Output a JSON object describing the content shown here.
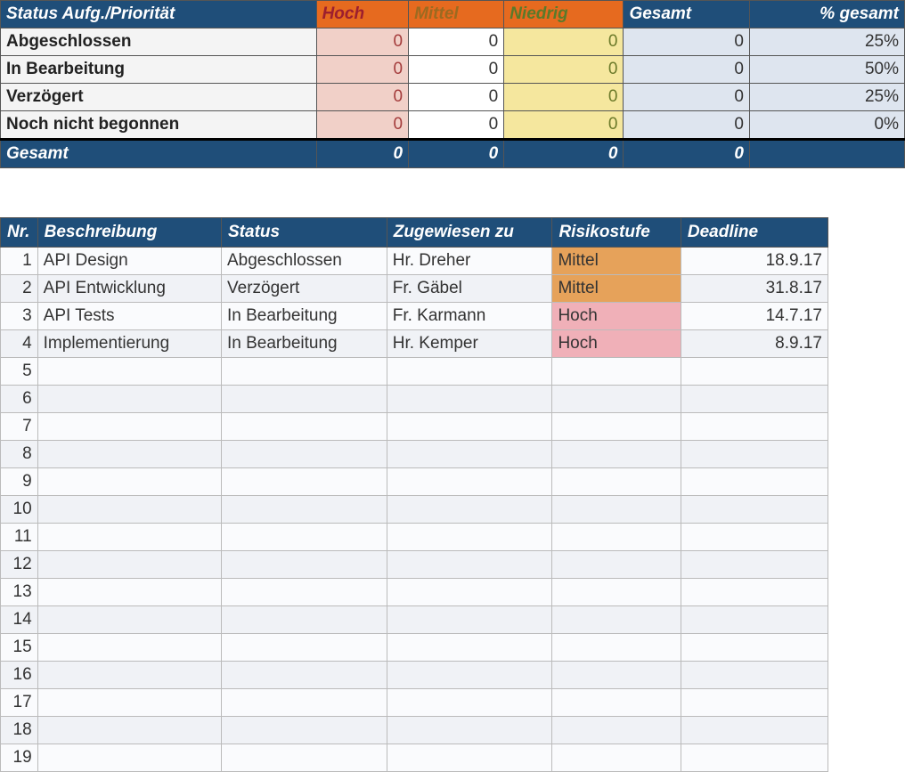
{
  "summary": {
    "header": {
      "main": "Status Aufg./Priorität",
      "hoch": "Hoch",
      "mittel": "Mittel",
      "niedrig": "Niedrig",
      "gesamt": "Gesamt",
      "pct": "% gesamt"
    },
    "rows": [
      {
        "label": "Abgeschlossen",
        "hoch": "0",
        "mittel": "0",
        "niedrig": "0",
        "gesamt": "0",
        "pct": "25%"
      },
      {
        "label": "In Bearbeitung",
        "hoch": "0",
        "mittel": "0",
        "niedrig": "0",
        "gesamt": "0",
        "pct": "50%"
      },
      {
        "label": "Verzögert",
        "hoch": "0",
        "mittel": "0",
        "niedrig": "0",
        "gesamt": "0",
        "pct": "25%"
      },
      {
        "label": "Noch nicht begonnen",
        "hoch": "0",
        "mittel": "0",
        "niedrig": "0",
        "gesamt": "0",
        "pct": "0%"
      }
    ],
    "total": {
      "label": "Gesamt",
      "hoch": "0",
      "mittel": "0",
      "niedrig": "0",
      "gesamt": "0",
      "pct": ""
    }
  },
  "tasks": {
    "header": {
      "nr": "Nr.",
      "desc": "Beschreibung",
      "status": "Status",
      "assigned": "Zugewiesen zu",
      "risk": "Risikostufe",
      "deadline": "Deadline"
    },
    "rows": [
      {
        "nr": "1",
        "desc": "API Design",
        "status": "Abgeschlossen",
        "assigned": "Hr. Dreher",
        "risk": "Mittel",
        "risk_class": "risk-mittel",
        "deadline": "18.9.17"
      },
      {
        "nr": "2",
        "desc": "API Entwicklung",
        "status": "Verzögert",
        "assigned": "Fr. Gäbel",
        "risk": "Mittel",
        "risk_class": "risk-mittel",
        "deadline": "31.8.17"
      },
      {
        "nr": "3",
        "desc": "API Tests",
        "status": "In Bearbeitung",
        "assigned": "Fr. Karmann",
        "risk": "Hoch",
        "risk_class": "risk-hoch",
        "deadline": "14.7.17"
      },
      {
        "nr": "4",
        "desc": "Implementierung",
        "status": "In Bearbeitung",
        "assigned": "Hr. Kemper",
        "risk": "Hoch",
        "risk_class": "risk-hoch",
        "deadline": "8.9.17"
      },
      {
        "nr": "5",
        "desc": "",
        "status": "",
        "assigned": "",
        "risk": "",
        "risk_class": "",
        "deadline": ""
      },
      {
        "nr": "6",
        "desc": "",
        "status": "",
        "assigned": "",
        "risk": "",
        "risk_class": "",
        "deadline": ""
      },
      {
        "nr": "7",
        "desc": "",
        "status": "",
        "assigned": "",
        "risk": "",
        "risk_class": "",
        "deadline": ""
      },
      {
        "nr": "8",
        "desc": "",
        "status": "",
        "assigned": "",
        "risk": "",
        "risk_class": "",
        "deadline": ""
      },
      {
        "nr": "9",
        "desc": "",
        "status": "",
        "assigned": "",
        "risk": "",
        "risk_class": "",
        "deadline": ""
      },
      {
        "nr": "10",
        "desc": "",
        "status": "",
        "assigned": "",
        "risk": "",
        "risk_class": "",
        "deadline": ""
      },
      {
        "nr": "11",
        "desc": "",
        "status": "",
        "assigned": "",
        "risk": "",
        "risk_class": "",
        "deadline": ""
      },
      {
        "nr": "12",
        "desc": "",
        "status": "",
        "assigned": "",
        "risk": "",
        "risk_class": "",
        "deadline": ""
      },
      {
        "nr": "13",
        "desc": "",
        "status": "",
        "assigned": "",
        "risk": "",
        "risk_class": "",
        "deadline": ""
      },
      {
        "nr": "14",
        "desc": "",
        "status": "",
        "assigned": "",
        "risk": "",
        "risk_class": "",
        "deadline": ""
      },
      {
        "nr": "15",
        "desc": "",
        "status": "",
        "assigned": "",
        "risk": "",
        "risk_class": "",
        "deadline": ""
      },
      {
        "nr": "16",
        "desc": "",
        "status": "",
        "assigned": "",
        "risk": "",
        "risk_class": "",
        "deadline": ""
      },
      {
        "nr": "17",
        "desc": "",
        "status": "",
        "assigned": "",
        "risk": "",
        "risk_class": "",
        "deadline": ""
      },
      {
        "nr": "18",
        "desc": "",
        "status": "",
        "assigned": "",
        "risk": "",
        "risk_class": "",
        "deadline": ""
      },
      {
        "nr": "19",
        "desc": "",
        "status": "",
        "assigned": "",
        "risk": "",
        "risk_class": "",
        "deadline": ""
      }
    ]
  }
}
